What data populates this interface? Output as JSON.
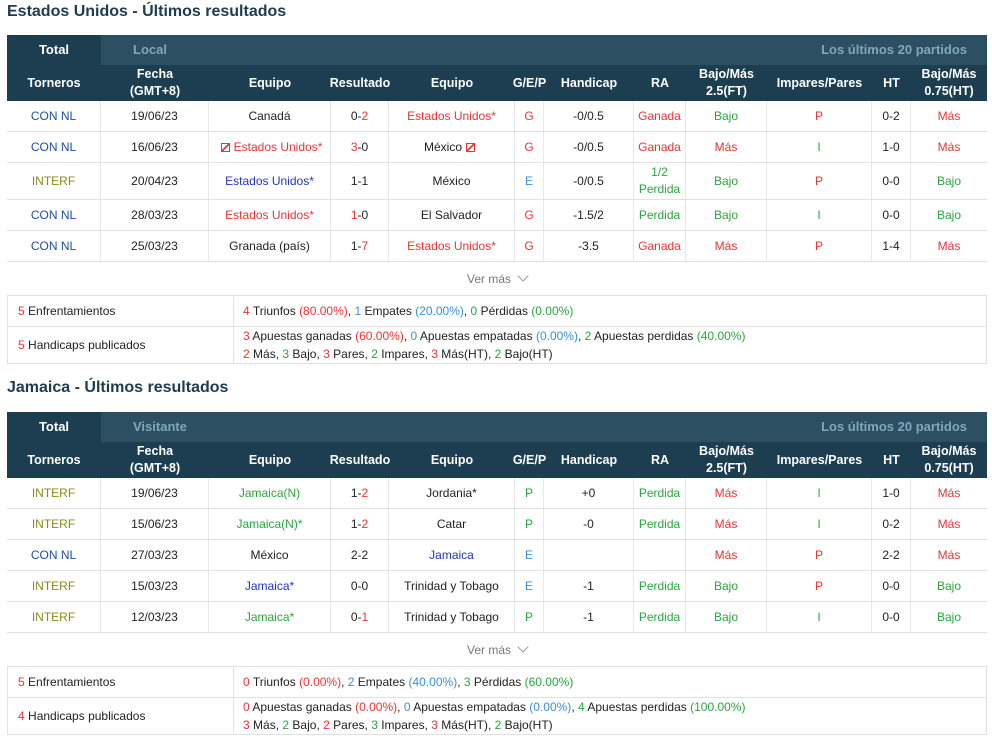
{
  "sections": [
    {
      "title": "Estados Unidos - Últimos resultados",
      "tab_total": "Total",
      "tab_filter": "Local",
      "tab_right": "Los últimos 20 partidos",
      "headers": [
        "Torneros",
        "Fecha\n(GMT+8)",
        "Equipo",
        "Resultado",
        "Equipo",
        "G/E/P",
        "Handicap",
        "RA",
        "Bajo/Más\n2.5(FT)",
        "Impares/Pares",
        "HT",
        "Bajo/Más\n0.75(HT)"
      ],
      "rows": [
        {
          "torneo": "CON NL",
          "fecha": "19/06/23",
          "home": "Canadá",
          "res_h": "0",
          "res_sep": "-",
          "res_a": "2",
          "away": "Estados Unidos*",
          "gep": "G",
          "handicap": "-0/0.5",
          "ra": "Ganada",
          "bm": "Bajo",
          "ip": "P",
          "ht": "0-2",
          "bm2": "Más"
        },
        {
          "torneo": "CON NL",
          "fecha": "16/06/23",
          "home": "Estados Unidos*",
          "res_h": "3",
          "res_sep": "-",
          "res_a": "0",
          "away": "México",
          "gep": "G",
          "handicap": "-0/0.5",
          "ra": "Ganada",
          "bm": "Más",
          "ip": "I",
          "ht": "1-0",
          "bm2": "Más"
        },
        {
          "torneo": "INTERF",
          "fecha": "20/04/23",
          "home": "Estados Unidos*",
          "res_h": "1",
          "res_sep": "-",
          "res_a": "1",
          "away": "México",
          "gep": "E",
          "handicap": "-0/0.5",
          "ra": "1/2\nPerdida",
          "bm": "Bajo",
          "ip": "P",
          "ht": "0-0",
          "bm2": "Bajo"
        },
        {
          "torneo": "CON NL",
          "fecha": "28/03/23",
          "home": "Estados Unidos*",
          "res_h": "1",
          "res_sep": "-",
          "res_a": "0",
          "away": "El Salvador",
          "gep": "G",
          "handicap": "-1.5/2",
          "ra": "Perdida",
          "bm": "Bajo",
          "ip": "I",
          "ht": "0-0",
          "bm2": "Bajo"
        },
        {
          "torneo": "CON NL",
          "fecha": "25/03/23",
          "home": "Granada (país)",
          "res_h": "1",
          "res_sep": "-",
          "res_a": "7",
          "away": "Estados Unidos*",
          "gep": "G",
          "handicap": "-3.5",
          "ra": "Ganada",
          "bm": "Más",
          "ip": "P",
          "ht": "1-4",
          "bm2": "Más"
        }
      ],
      "more": "Ver más",
      "summary": {
        "enf_count": "5",
        "enf_label": "Enfrentamientos",
        "enf": {
          "w": "4",
          "w_lbl": "Triunfos",
          "w_pct": "(80.00%)",
          "d": "1",
          "d_lbl": "Empates",
          "d_pct": "(20.00%)",
          "l": "0",
          "l_lbl": "Pérdidas",
          "l_pct": "(0.00%)"
        },
        "hc_count": "5",
        "hc_label": "Handicaps publicados",
        "hc": {
          "w": "3",
          "w_lbl": "Apuestas ganadas",
          "w_pct": "(60.00%)",
          "d": "0",
          "d_lbl": "Apuestas empatadas",
          "d_pct": "(0.00%)",
          "l": "2",
          "l_lbl": "Apuestas perdidas",
          "l_pct": "(40.00%)"
        },
        "ou": {
          "mas": "2",
          "mas_lbl": "Más,",
          "bajo": "3",
          "bajo_lbl": "Bajo,",
          "pares": "3",
          "pares_lbl": "Pares,",
          "imp": "2",
          "imp_lbl": "Impares,",
          "masht": "3",
          "masht_lbl": "Más(HT),",
          "bajoht": "2",
          "bajoht_lbl": "Bajo(HT)"
        }
      }
    },
    {
      "title": "Jamaica - Últimos resultados",
      "tab_total": "Total",
      "tab_filter": "Visitante",
      "tab_right": "Los últimos 20 partidos",
      "headers": [
        "Torneros",
        "Fecha\n(GMT+8)",
        "Equipo",
        "Resultado",
        "Equipo",
        "G/E/P",
        "Handicap",
        "RA",
        "Bajo/Más\n2.5(FT)",
        "Impares/Pares",
        "HT",
        "Bajo/Más\n0.75(HT)"
      ],
      "rows": [
        {
          "torneo": "INTERF",
          "fecha": "19/06/23",
          "home": "Jamaica(N)",
          "res_h": "1",
          "res_sep": "-",
          "res_a": "2",
          "away": "Jordania*",
          "gep": "P",
          "handicap": "+0",
          "ra": "Perdida",
          "bm": "Más",
          "ip": "I",
          "ht": "1-0",
          "bm2": "Más"
        },
        {
          "torneo": "INTERF",
          "fecha": "15/06/23",
          "home": "Jamaica(N)*",
          "res_h": "1",
          "res_sep": "-",
          "res_a": "2",
          "away": "Catar",
          "gep": "P",
          "handicap": "-0",
          "ra": "Perdida",
          "bm": "Más",
          "ip": "I",
          "ht": "0-2",
          "bm2": "Más"
        },
        {
          "torneo": "CON NL",
          "fecha": "27/03/23",
          "home": "México",
          "res_h": "2",
          "res_sep": "-",
          "res_a": "2",
          "away": "Jamaica",
          "gep": "E",
          "handicap": "",
          "ra": "",
          "bm": "Más",
          "ip": "P",
          "ht": "2-2",
          "bm2": "Más"
        },
        {
          "torneo": "INTERF",
          "fecha": "15/03/23",
          "home": "Jamaica*",
          "res_h": "0",
          "res_sep": "-",
          "res_a": "0",
          "away": "Trinidad y Tobago",
          "gep": "E",
          "handicap": "-1",
          "ra": "Perdida",
          "bm": "Bajo",
          "ip": "P",
          "ht": "0-0",
          "bm2": "Bajo"
        },
        {
          "torneo": "INTERF",
          "fecha": "12/03/23",
          "home": "Jamaica*",
          "res_h": "0",
          "res_sep": "-",
          "res_a": "1",
          "away": "Trinidad y Tobago",
          "gep": "P",
          "handicap": "-1",
          "ra": "Perdida",
          "bm": "Bajo",
          "ip": "I",
          "ht": "0-0",
          "bm2": "Bajo"
        }
      ],
      "more": "Ver más",
      "summary": {
        "enf_count": "5",
        "enf_label": "Enfrentamientos",
        "enf": {
          "w": "0",
          "w_lbl": "Triunfos",
          "w_pct": "(0.00%)",
          "d": "2",
          "d_lbl": "Empates",
          "d_pct": "(40.00%)",
          "l": "3",
          "l_lbl": "Pérdidas",
          "l_pct": "(60.00%)"
        },
        "hc_count": "4",
        "hc_label": "Handicaps publicados",
        "hc": {
          "w": "0",
          "w_lbl": "Apuestas ganadas",
          "w_pct": "(0.00%)",
          "d": "0",
          "d_lbl": "Apuestas empatadas",
          "d_pct": "(0.00%)",
          "l": "4",
          "l_lbl": "Apuestas perdidas",
          "l_pct": "(100.00%)"
        },
        "ou": {
          "mas": "3",
          "mas_lbl": "Más,",
          "bajo": "2",
          "bajo_lbl": "Bajo,",
          "pares": "2",
          "pares_lbl": "Pares,",
          "imp": "3",
          "imp_lbl": "Impares,",
          "masht": "3",
          "masht_lbl": "Más(HT),",
          "bajoht": "2",
          "bajoht_lbl": "Bajo(HT)"
        }
      }
    }
  ],
  "colors": {
    "header_bg": "#1d3e51",
    "tab_inactive_bg": "#2c4f61",
    "win": "#2aa63c",
    "loss": "#e33333",
    "draw": "#3a8fd9",
    "title": "#1d3c4f"
  },
  "icons": [
    "flag-icon",
    "chevron-down-icon"
  ]
}
